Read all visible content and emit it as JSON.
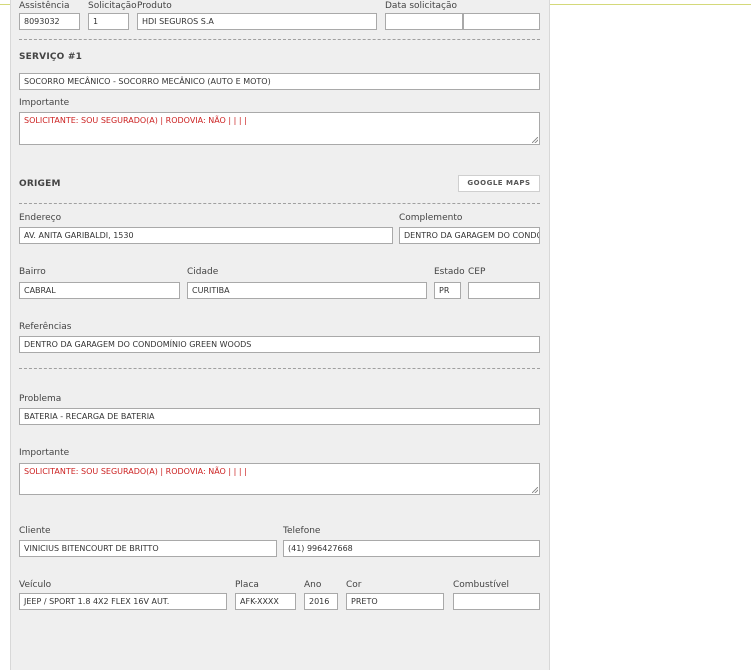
{
  "top": {
    "assistencia_label": "Assistência",
    "assistencia_value": "8093032",
    "solicitacao_label": "Solicitação",
    "solicitacao_value": "1",
    "produto_label": "Produto",
    "produto_value": "HDI SEGUROS S.A",
    "data_label": "Data solicitação",
    "data_value_a": "",
    "data_value_b": ""
  },
  "servico": {
    "title": "SERVIÇO #1",
    "value": "SOCORRO MECÂNICO - SOCORRO MECÂNICO (AUTO E MOTO)",
    "importante_label": "Importante",
    "importante_value": "SOLICITANTE: SOU SEGURADO(A) | RODOVIA: NÃO |  |  |  |"
  },
  "origem": {
    "title": "ORIGEM",
    "maps_button": "GOOGLE MAPS",
    "endereco_label": "Endereço",
    "endereco_value": "AV. ANITA GARIBALDI, 1530",
    "complemento_label": "Complemento",
    "complemento_value": "DENTRO DA GARAGEM DO CONDOMÍNIO",
    "bairro_label": "Bairro",
    "bairro_value": "CABRAL",
    "cidade_label": "Cidade",
    "cidade_value": "CURITIBA",
    "estado_label": "Estado",
    "estado_value": "PR",
    "cep_label": "CEP",
    "cep_value": "",
    "referencias_label": "Referências",
    "referencias_value": "DENTRO DA GARAGEM DO CONDOMÍNIO GREEN WOODS"
  },
  "problema": {
    "label": "Problema",
    "value": "BATERIA - RECARGA DE BATERIA",
    "importante_label": "Importante",
    "importante_value": "SOLICITANTE: SOU SEGURADO(A) | RODOVIA: NÃO |  |  |  |"
  },
  "cliente": {
    "cliente_label": "Cliente",
    "cliente_value": "VINICIUS BITENCOURT DE BRITTO",
    "telefone_label": "Telefone",
    "telefone_value": "(41) 996427668"
  },
  "veiculo": {
    "veiculo_label": "Veículo",
    "veiculo_value": "JEEP / SPORT 1.8 4X2 FLEX 16V AUT.",
    "placa_label": "Placa",
    "placa_value": "AFK-XXXX",
    "ano_label": "Ano",
    "ano_value": "2016",
    "cor_label": "Cor",
    "cor_value": "PRETO",
    "combustivel_label": "Combustível",
    "combustivel_value": ""
  }
}
